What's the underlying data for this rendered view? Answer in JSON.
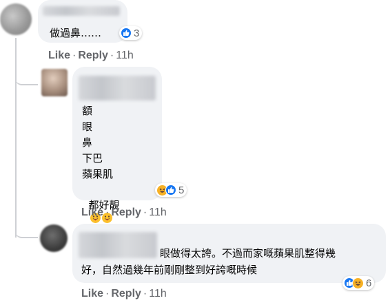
{
  "comments": [
    {
      "lines": [
        "做過鼻……"
      ],
      "reaction_count": "3",
      "actions": {
        "like": "Like",
        "reply": "Reply",
        "time": "11h",
        "sep": "·"
      }
    },
    {
      "lines": [
        "額",
        "眼",
        "鼻",
        "下巴",
        "蘋果肌",
        "都好靚"
      ],
      "reaction_count": "5",
      "actions": {
        "like": "Like",
        "reply": "Reply",
        "time": "11h",
        "sep": "·"
      }
    },
    {
      "lines": [
        "眼做得太誇。不過而家嘅蘋果肌整得幾",
        "好，自然過幾年前剛剛整到好誇嘅時候"
      ],
      "reaction_count": "6",
      "actions": {
        "like": "Like",
        "reply": "Reply",
        "time": "11h",
        "sep": "·"
      }
    }
  ],
  "icons": {
    "like": "like-thumb-icon",
    "haha": "haha-face-icon",
    "tongue": "tongue-out-emoji-icon"
  },
  "colors": {
    "bubble": "#f0f2f5",
    "meta": "#65676b",
    "like_blue": "#1877f2",
    "haha_yellow": "#f7b125"
  }
}
